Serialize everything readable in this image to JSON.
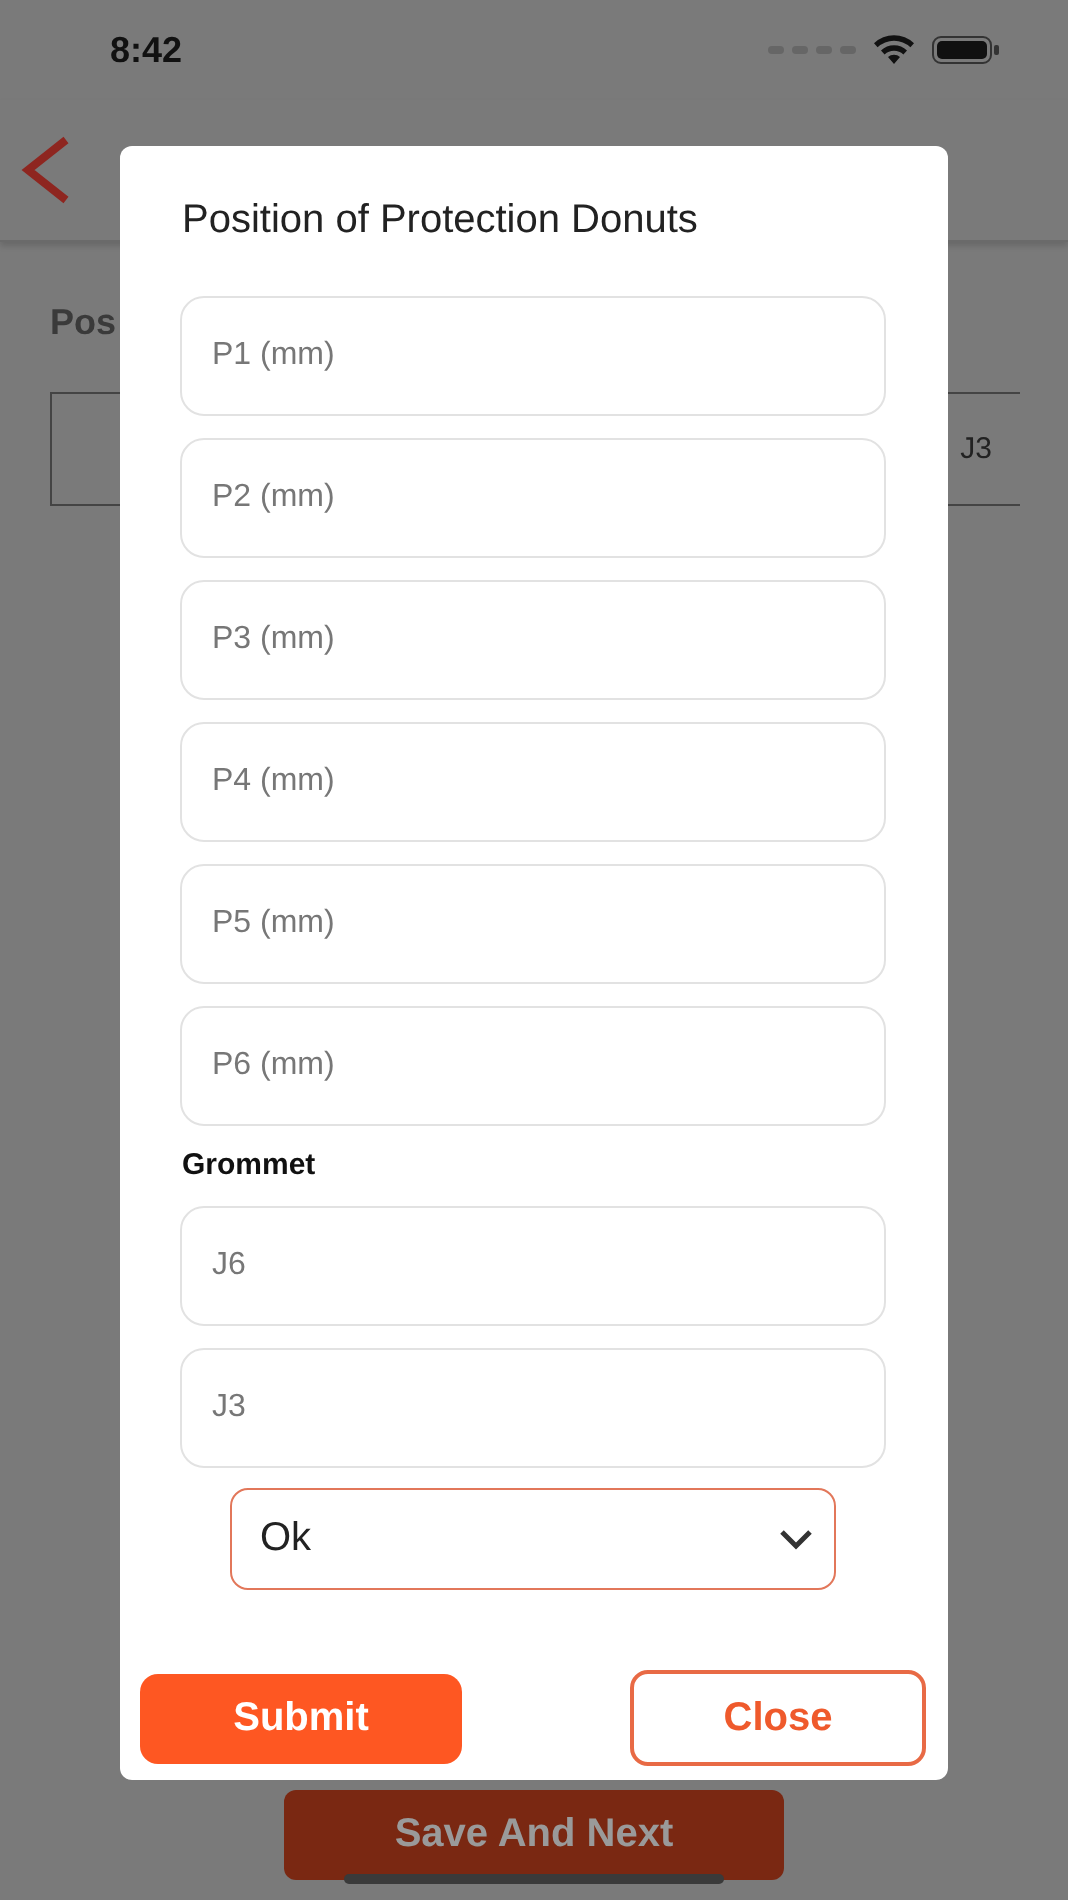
{
  "status_bar": {
    "time": "8:42"
  },
  "page": {
    "heading": "Pos",
    "table": {
      "column_last": "J3"
    },
    "save_button": "Save And Next"
  },
  "dialog": {
    "title": "Position of Protection Donuts",
    "fields": [
      {
        "placeholder": "P1 (mm)"
      },
      {
        "placeholder": "P2 (mm)"
      },
      {
        "placeholder": "P3 (mm)"
      },
      {
        "placeholder": "P4 (mm)"
      },
      {
        "placeholder": "P5 (mm)"
      },
      {
        "placeholder": "P6 (mm)"
      }
    ],
    "grommet": {
      "label": "Grommet",
      "fields": [
        {
          "placeholder": "J6"
        },
        {
          "placeholder": "J3"
        }
      ]
    },
    "dropdown": {
      "value": "Ok"
    },
    "buttons": [
      {
        "label": "Submit",
        "kind": "primary"
      },
      {
        "label": "Close",
        "kind": "outline"
      }
    ]
  }
}
